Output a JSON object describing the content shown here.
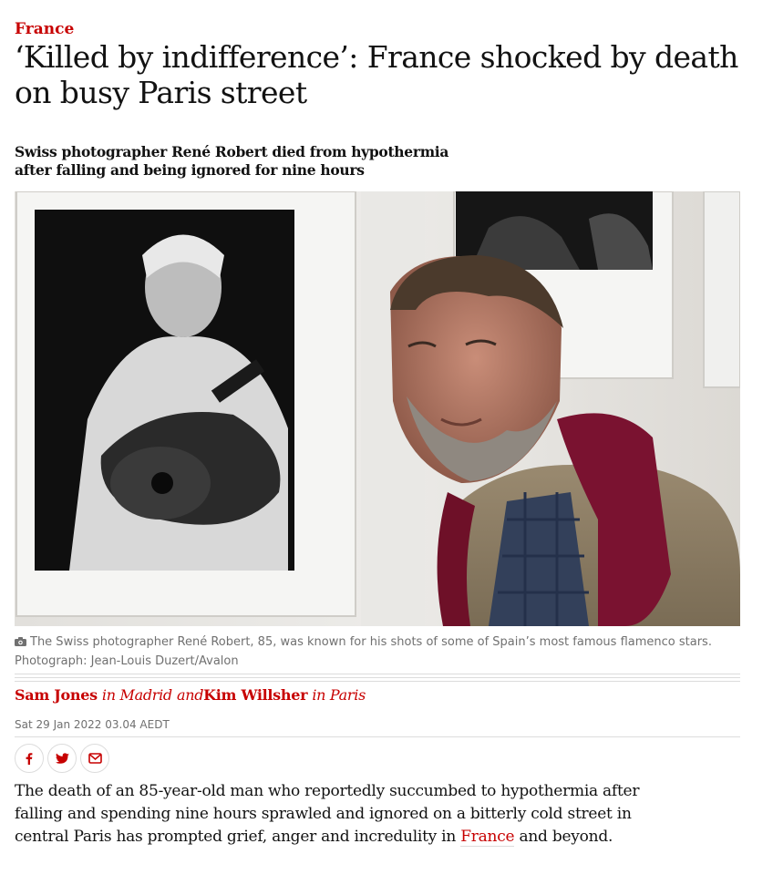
{
  "article": {
    "section": "France",
    "headline": "‘Killed by indifference’: France shocked by death on busy Paris street",
    "standfirst": "Swiss photographer René Robert died from hypothermia after falling and being ignored for nine hours",
    "image": {
      "alt": "René Robert beside his photograph of a flamenco guitarist"
    },
    "caption": {
      "text": "The Swiss photographer René Robert, 85, was known for his shots of some of Spain’s most famous flamenco stars.",
      "credit": "Photograph: Jean-Louis Duzert/Avalon"
    },
    "byline": {
      "author1": "Sam Jones",
      "loc1": "in Madrid",
      "and": "and",
      "author2": "Kim Willsher",
      "loc2": "in Paris"
    },
    "date": "Sat 29 Jan 2022 03.04 AEDT",
    "share": {
      "facebook_icon": "facebook-icon",
      "twitter_icon": "twitter-icon",
      "email_icon": "email-icon"
    },
    "body": {
      "before_link": "The death of an 85-year-old man who reportedly succumbed to hypothermia after falling and spending nine hours sprawled and ignored on a bitterly cold street in central Paris has prompted grief, anger and incredulity in ",
      "link_text": "France",
      "after_link": " and beyond."
    },
    "colors": {
      "accent": "#c70000",
      "text": "#121212",
      "muted": "#707070",
      "rule": "#dcdcdc"
    }
  }
}
